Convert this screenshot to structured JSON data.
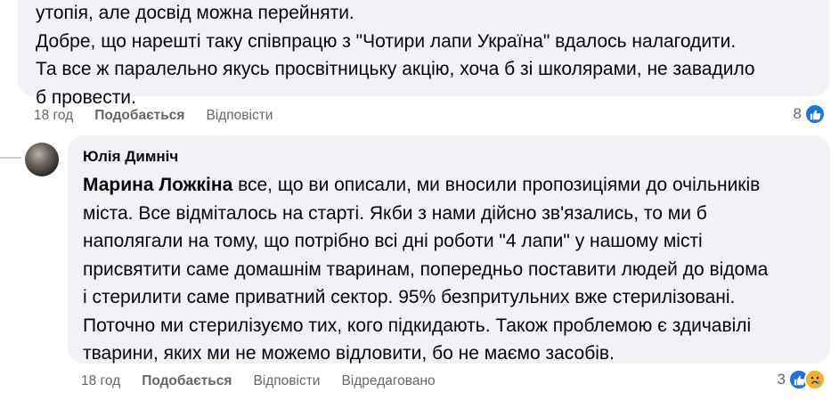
{
  "previous_comment": {
    "text_lines": [
      "утопія, але досвід можна перейняти.",
      "Добре, що нарешті таку співпрацю з \"Чотири лапи Україна\" вдалось налагодити.",
      "Та все ж паралельно якусь просвітницьку акцію, хоча б зі школярами, не завадило",
      "б провести."
    ],
    "time": "18 год",
    "like_label": "Подобається",
    "reply_label": "Відповісти",
    "reaction_count": "8"
  },
  "reply_comment": {
    "author": "Юлія Димніч",
    "mention": "Марина Ложкіна",
    "first_line_rest": " все, що ви описали, ми вносили пропозиціями до очільників",
    "text_lines": [
      "міста. Все відміталось на старті. Якби з нами дійсно зв'язались, то ми б",
      "наполягали на тому, що потрібно всі дні роботи \"4 лапи\" у нашому місті",
      "присвятити саме домашнім тваринам, попередньо поставити людей до відома",
      "і стерилити саме приватний сектор. 95% безпритульних вже стерилізовані.",
      "Поточно ми стерилізуємо тих, кого підкидають. Також проблемою є здичавілі",
      "тварини, яких ми не можемо відловити, бо не маємо засобів."
    ],
    "time": "18 год",
    "like_label": "Подобається",
    "reply_label": "Відповісти",
    "edited_label": "Відредаговано",
    "reaction_count": "3"
  },
  "icons": {
    "like": "like-reaction-icon",
    "sad": "sad-reaction-icon"
  },
  "colors": {
    "bubble": "#f0f2f5",
    "meta_text": "#65676b",
    "like_blue": "#1b74e4",
    "sad_yellow": "#f7b125"
  }
}
